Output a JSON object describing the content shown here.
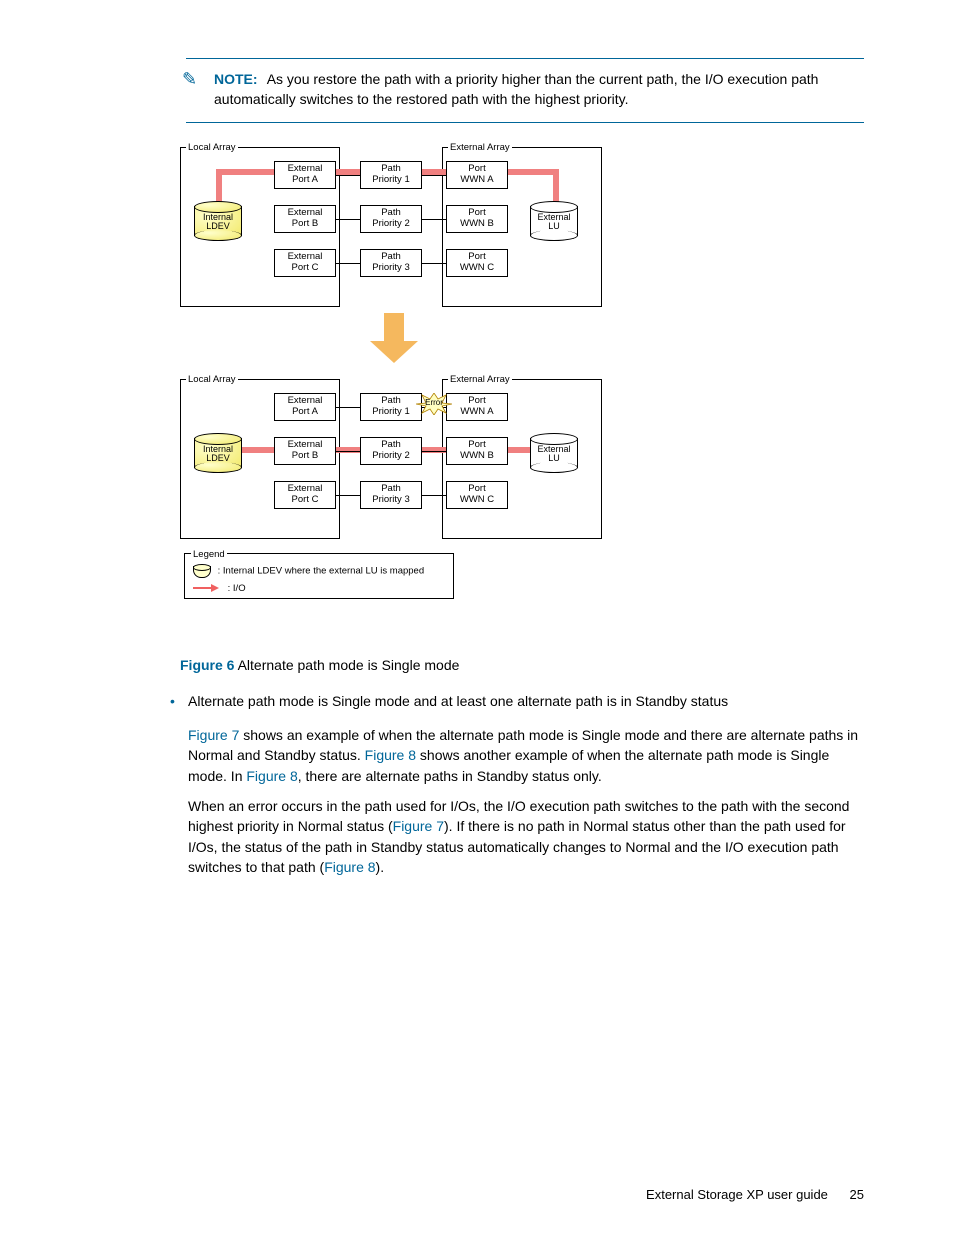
{
  "note": {
    "label": "NOTE:",
    "text": "As you restore the path with a priority higher than the current path, the I/O execution path automatically switches to the restored path with the highest priority."
  },
  "diagram": {
    "top": {
      "local_array": "Local Array",
      "external_array": "External Array",
      "internal_ldev": "Internal\nLDEV",
      "external_lu": "External\nLU",
      "cols": {
        "ext_port_a": "External\nPort A",
        "ext_port_b": "External\nPort B",
        "ext_port_c": "External\nPort C",
        "path1": "Path\nPriority 1",
        "path2": "Path\nPriority 2",
        "path3": "Path\nPriority 3",
        "wwn_a": "Port\nWWN A",
        "wwn_b": "Port\nWWN B",
        "wwn_c": "Port\nWWN C"
      }
    },
    "bottom": {
      "local_array": "Local Array",
      "external_array": "External Array",
      "internal_ldev": "Internal\nLDEV",
      "external_lu": "External\nLU",
      "error": "Error",
      "cols": {
        "ext_port_a": "External\nPort A",
        "ext_port_b": "External\nPort B",
        "ext_port_c": "External\nPort C",
        "path1": "Path\nPriority 1",
        "path2": "Path\nPriority 2",
        "path3": "Path\nPriority 3",
        "wwn_a": "Port\nWWN A",
        "wwn_b": "Port\nWWN B",
        "wwn_c": "Port\nWWN C"
      }
    },
    "legend": {
      "title": "Legend",
      "item1": ": Internal LDEV where the external LU is mapped",
      "item2": ": I/O"
    }
  },
  "caption": {
    "label": "Figure 6",
    "text": "Alternate path mode is Single mode"
  },
  "bullet": {
    "item1": "Alternate path mode is Single mode and at least one alternate path is in Standby status"
  },
  "p1": {
    "xref_fig7_a": "Figure 7",
    "t1": " shows an example of when the alternate path mode is Single mode and there are alternate paths in Normal and Standby status. ",
    "xref_fig8_a": "Figure 8",
    "t2": " shows another example of when the alternate path mode is Single mode. In ",
    "xref_fig8_b": "Figure 8",
    "t3": ", there are alternate paths in Standby status only."
  },
  "p2": {
    "t1": "When an error occurs in the path used for I/Os, the I/O execution path switches to the path with the second highest priority in Normal status (",
    "xref_fig7": "Figure 7",
    "t2": "). If there is no path in Normal status other than the path used for I/Os, the status of the path in Standby status automatically changes to Normal and the I/O execution path switches to that path (",
    "xref_fig8": "Figure 8",
    "t3": ")."
  },
  "footer": {
    "title": "External Storage XP user guide",
    "page": "25"
  }
}
